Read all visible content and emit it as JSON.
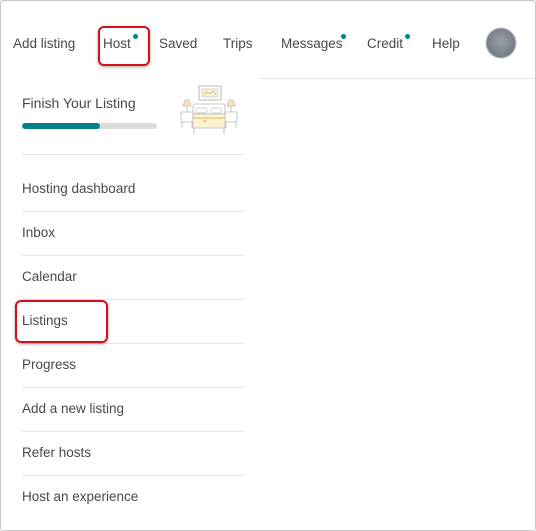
{
  "nav": {
    "items": [
      {
        "label": "Add listing"
      },
      {
        "label": "Host"
      },
      {
        "label": "Saved"
      },
      {
        "label": "Trips"
      },
      {
        "label": "Messages"
      },
      {
        "label": "Credit"
      },
      {
        "label": "Help"
      }
    ]
  },
  "dropdown": {
    "finish_title": "Finish Your Listing",
    "progress_fraction": 0.58,
    "menu": [
      {
        "label": "Hosting dashboard"
      },
      {
        "label": "Inbox"
      },
      {
        "label": "Calendar"
      },
      {
        "label": "Listings"
      },
      {
        "label": "Progress"
      },
      {
        "label": "Add a new listing"
      },
      {
        "label": "Refer hosts"
      },
      {
        "label": "Host an experience"
      }
    ]
  },
  "colors": {
    "accent_teal": "#008489",
    "highlight_red": "#d0111a",
    "text": "#484848"
  },
  "icons": [
    "notification-dot-icon",
    "avatar-image",
    "bedroom-illustration"
  ]
}
